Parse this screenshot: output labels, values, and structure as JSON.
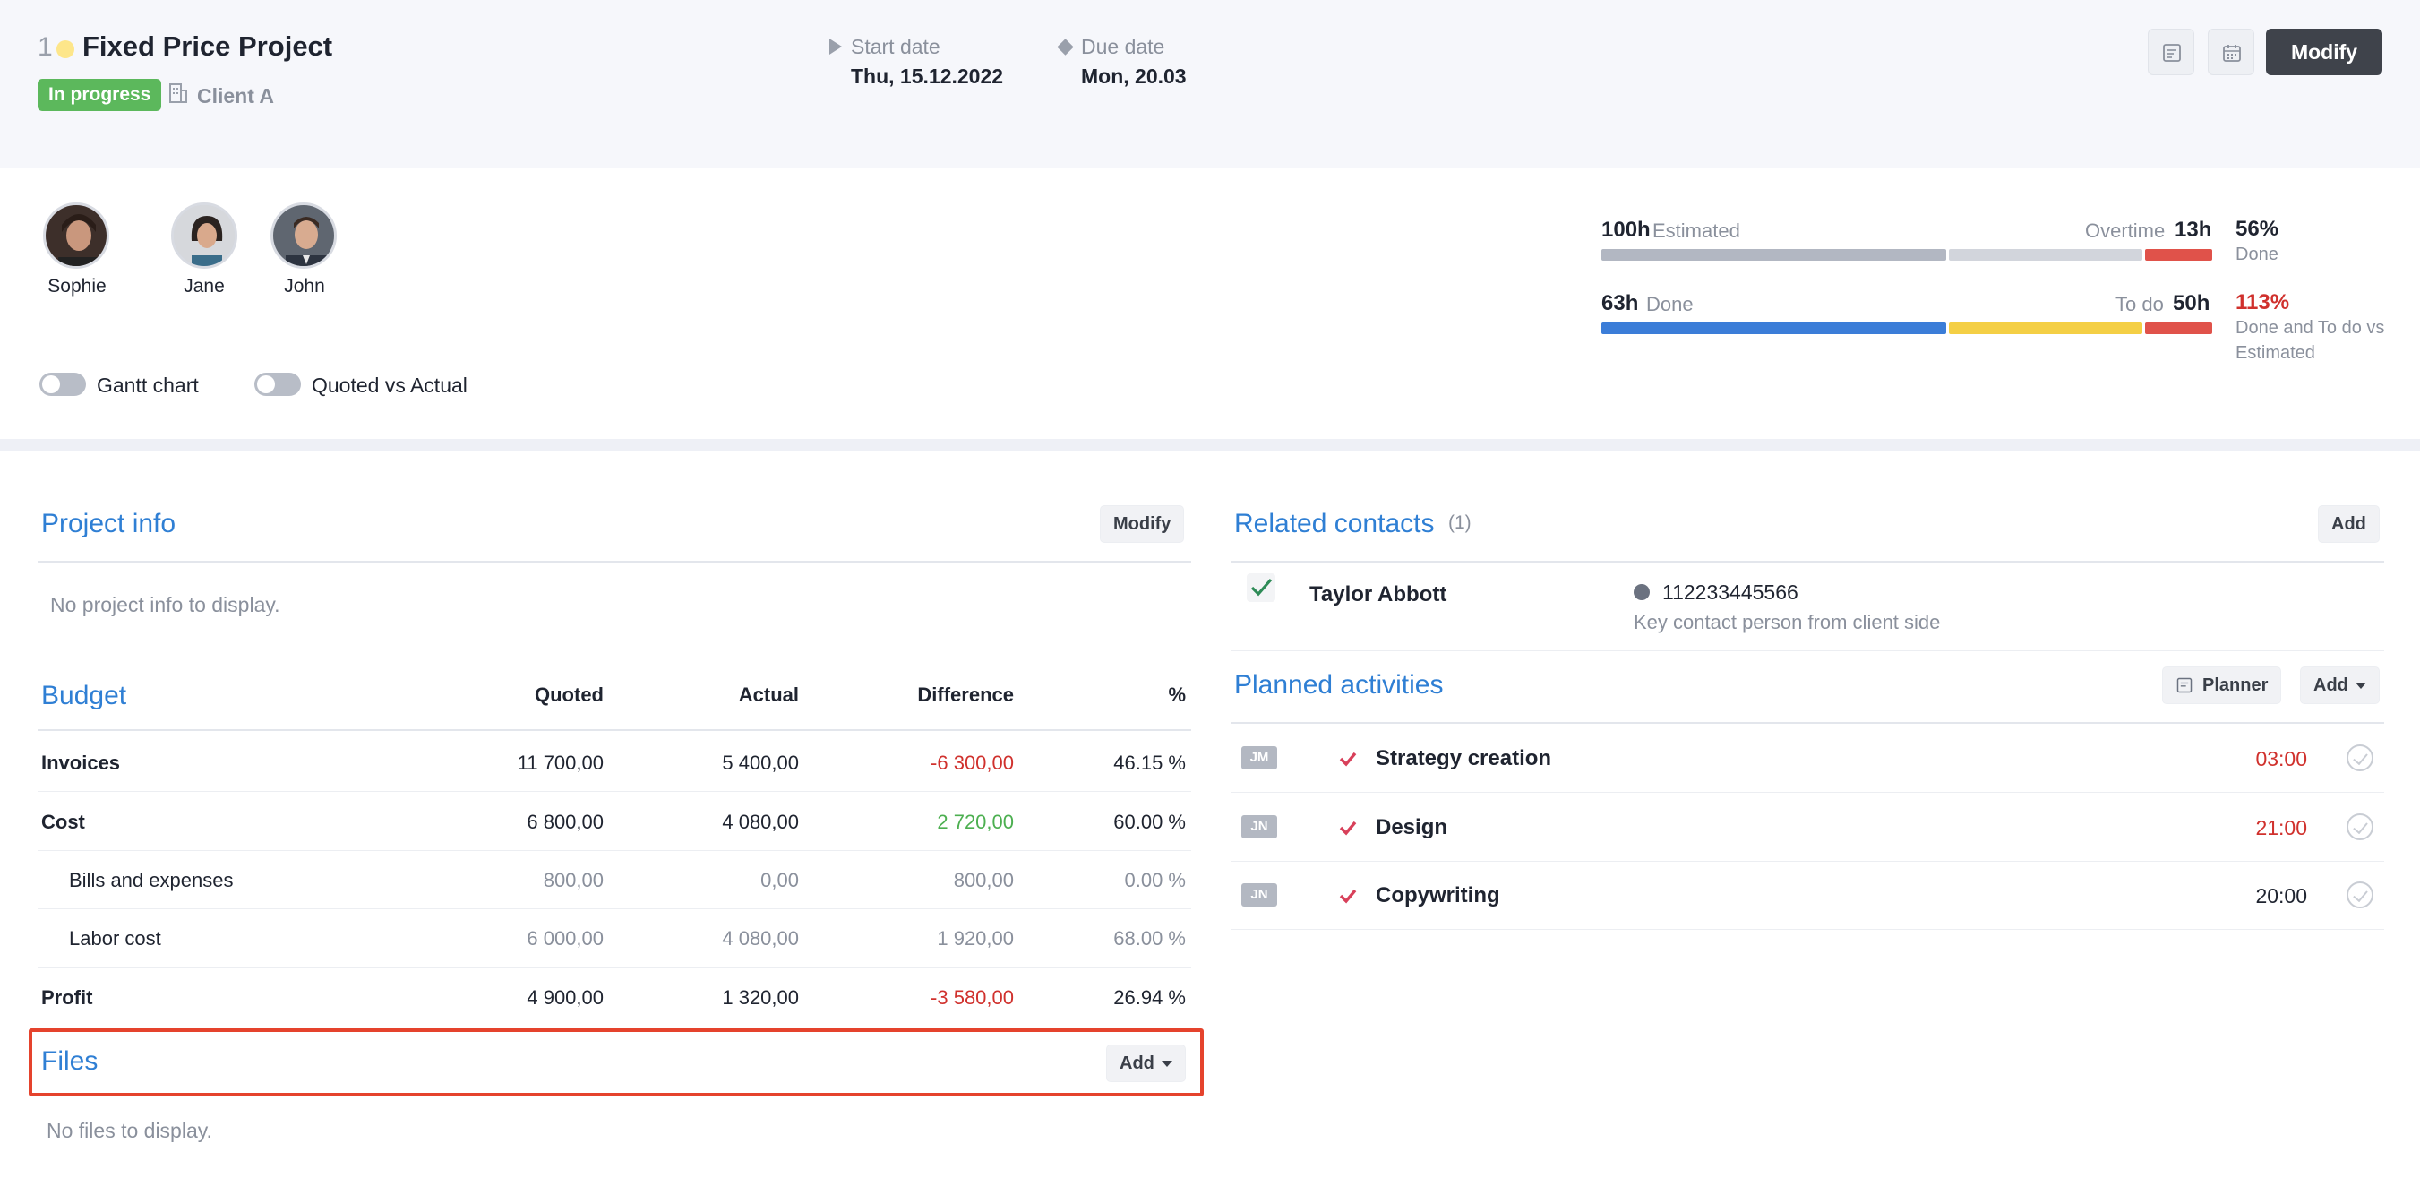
{
  "header": {
    "project_number": "1",
    "project_title": "Fixed Price Project",
    "status": "In progress",
    "client": "Client A",
    "start_label": "Start date",
    "start_value": "Thu, 15.12.2022",
    "due_label": "Due date",
    "due_value": "Mon, 20.03",
    "modify_label": "Modify",
    "icon_buttons": [
      "planner-icon",
      "calendar-icon"
    ]
  },
  "team": [
    {
      "name": "Sophie"
    },
    {
      "name": "Jane"
    },
    {
      "name": "John"
    }
  ],
  "toggles": {
    "gantt": "Gantt chart",
    "quoted": "Quoted vs Actual"
  },
  "progress": {
    "estimated_hours": "100h",
    "estimated_label": "Estimated",
    "overtime_label": "Overtime",
    "overtime_hours": "13h",
    "done_pct": "56%",
    "done_pct_label": "Done",
    "done_hours": "63h",
    "done_label": "Done",
    "todo_label": "To do",
    "todo_hours": "50h",
    "combined_pct": "113%",
    "combined_label": "Done and To do vs Estimated"
  },
  "project_info": {
    "title": "Project info",
    "modify_label": "Modify",
    "empty": "No project info to display."
  },
  "budget": {
    "title": "Budget",
    "columns": [
      "Quoted",
      "Actual",
      "Difference",
      "%"
    ],
    "rows": [
      {
        "label": "Invoices",
        "quoted": "11 700,00",
        "actual": "5 400,00",
        "difference": "-6 300,00",
        "pct": "46.15 %"
      },
      {
        "label": "Cost",
        "quoted": "6 800,00",
        "actual": "4 080,00",
        "difference": "2 720,00",
        "pct": "60.00 %"
      },
      {
        "label": "Bills and expenses",
        "quoted": "800,00",
        "actual": "0,00",
        "difference": "800,00",
        "pct": "0.00 %"
      },
      {
        "label": "Labor cost",
        "quoted": "6 000,00",
        "actual": "4 080,00",
        "difference": "1 920,00",
        "pct": "68.00 %"
      },
      {
        "label": "Profit",
        "quoted": "4 900,00",
        "actual": "1 320,00",
        "difference": "-3 580,00",
        "pct": "26.94 %"
      }
    ]
  },
  "files": {
    "title": "Files",
    "add_label": "Add",
    "empty": "No files to display."
  },
  "contacts": {
    "title": "Related contacts",
    "count": "(1)",
    "add_label": "Add",
    "items": [
      {
        "name": "Taylor Abbott",
        "phone": "112233445566",
        "note": "Key contact person from client side"
      }
    ]
  },
  "activities": {
    "title": "Planned activities",
    "planner_label": "Planner",
    "add_label": "Add",
    "items": [
      {
        "initials": "JM",
        "name": "Strategy creation",
        "time": "03:00"
      },
      {
        "initials": "JN",
        "name": "Design",
        "time": "21:00"
      },
      {
        "initials": "JN",
        "name": "Copywriting",
        "time": "20:00"
      }
    ]
  },
  "colors": {
    "accent": "#2f7fd4",
    "status_green": "#5cb85c",
    "negative_red": "#d0312d",
    "positive_green": "#4caf50",
    "bar_blue": "#3b7dd8",
    "bar_yellow": "#f4cf45",
    "bar_red": "#e0524a",
    "bar_gray": "#b2b7c2",
    "highlight": "#e5432d"
  }
}
